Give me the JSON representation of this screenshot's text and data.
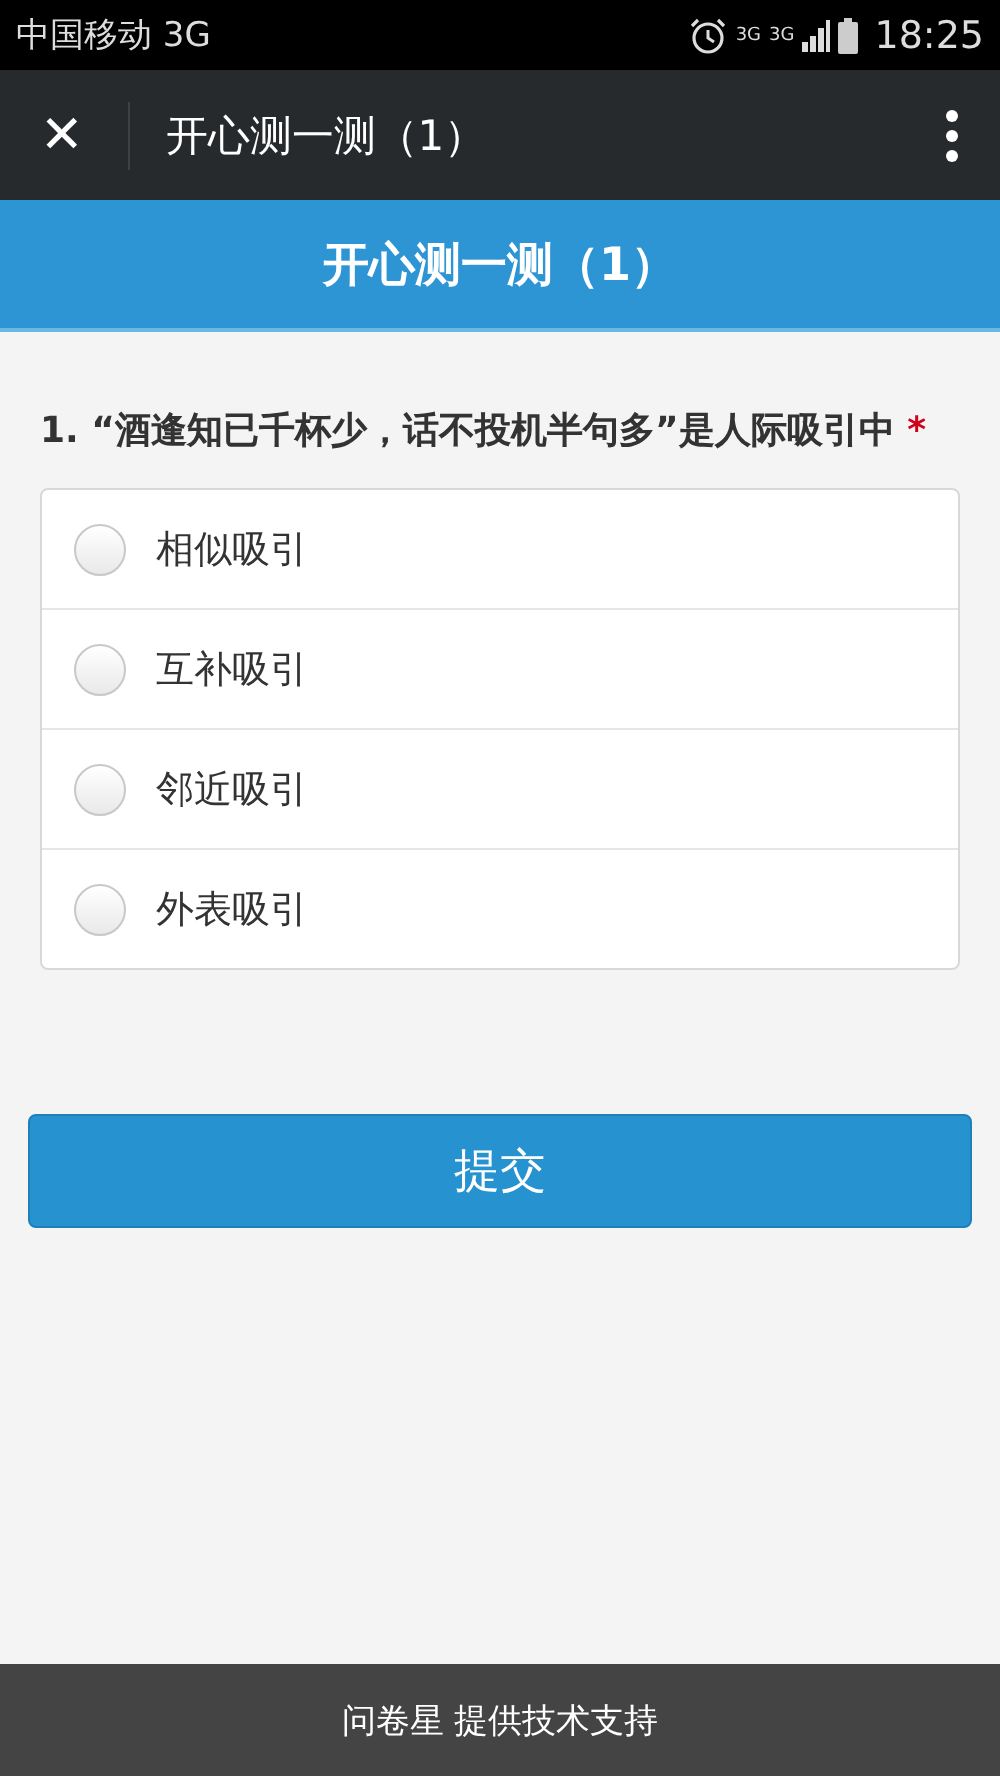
{
  "status_bar": {
    "carrier": "中国移动 3G",
    "network_labels": [
      "3G",
      "3G"
    ],
    "time": "18:25"
  },
  "app_bar": {
    "close": "✕",
    "title": "开心测一测（1）"
  },
  "header": {
    "title": "开心测一测（1）"
  },
  "question": {
    "text": "1. “酒逢知已千杯少，话不投机半句多”是人际吸引中",
    "required_mark": "*",
    "options": [
      {
        "label": "相似吸引",
        "selected": false
      },
      {
        "label": "互补吸引",
        "selected": false
      },
      {
        "label": "邻近吸引",
        "selected": false
      },
      {
        "label": "外表吸引",
        "selected": false
      }
    ]
  },
  "submit_button": "提交",
  "footer": "问卷星 提供技术支持"
}
